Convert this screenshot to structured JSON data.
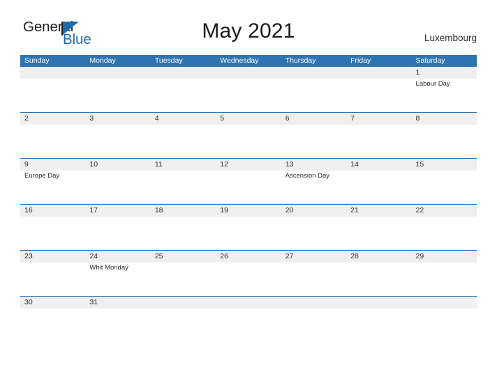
{
  "logo": {
    "word1": "General",
    "word2": "Blue",
    "triangle_color": "#1b6ca8",
    "icon": "triangle-icon"
  },
  "header": {
    "title": "May 2021",
    "country": "Luxembourg"
  },
  "theme": {
    "header_blue": "#2f74b2",
    "row_divider_blue": "#2f74b2",
    "date_band_gray": "#efefef",
    "text_dark": "#2b2b2b",
    "white": "#ffffff"
  },
  "calendar": {
    "weekdays": [
      "Sunday",
      "Monday",
      "Tuesday",
      "Wednesday",
      "Thursday",
      "Friday",
      "Saturday"
    ],
    "weeks": [
      [
        {
          "date": "",
          "event": ""
        },
        {
          "date": "",
          "event": ""
        },
        {
          "date": "",
          "event": ""
        },
        {
          "date": "",
          "event": ""
        },
        {
          "date": "",
          "event": ""
        },
        {
          "date": "",
          "event": ""
        },
        {
          "date": "1",
          "event": "Labour Day"
        }
      ],
      [
        {
          "date": "2",
          "event": ""
        },
        {
          "date": "3",
          "event": ""
        },
        {
          "date": "4",
          "event": ""
        },
        {
          "date": "5",
          "event": ""
        },
        {
          "date": "6",
          "event": ""
        },
        {
          "date": "7",
          "event": ""
        },
        {
          "date": "8",
          "event": ""
        }
      ],
      [
        {
          "date": "9",
          "event": "Europe Day"
        },
        {
          "date": "10",
          "event": ""
        },
        {
          "date": "11",
          "event": ""
        },
        {
          "date": "12",
          "event": ""
        },
        {
          "date": "13",
          "event": "Ascension Day"
        },
        {
          "date": "14",
          "event": ""
        },
        {
          "date": "15",
          "event": ""
        }
      ],
      [
        {
          "date": "16",
          "event": ""
        },
        {
          "date": "17",
          "event": ""
        },
        {
          "date": "18",
          "event": ""
        },
        {
          "date": "19",
          "event": ""
        },
        {
          "date": "20",
          "event": ""
        },
        {
          "date": "21",
          "event": ""
        },
        {
          "date": "22",
          "event": ""
        }
      ],
      [
        {
          "date": "23",
          "event": ""
        },
        {
          "date": "24",
          "event": "Whit Monday"
        },
        {
          "date": "25",
          "event": ""
        },
        {
          "date": "26",
          "event": ""
        },
        {
          "date": "27",
          "event": ""
        },
        {
          "date": "28",
          "event": ""
        },
        {
          "date": "29",
          "event": ""
        }
      ],
      [
        {
          "date": "30",
          "event": ""
        },
        {
          "date": "31",
          "event": ""
        },
        {
          "date": "",
          "event": ""
        },
        {
          "date": "",
          "event": ""
        },
        {
          "date": "",
          "event": ""
        },
        {
          "date": "",
          "event": ""
        },
        {
          "date": "",
          "event": ""
        }
      ]
    ]
  }
}
